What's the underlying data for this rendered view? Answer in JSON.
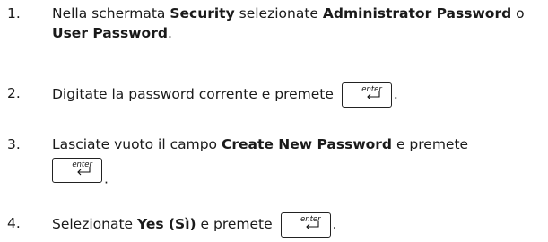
{
  "steps": [
    {
      "num": "1.",
      "t1": "Nella schermata ",
      "b1": "Security",
      "t2": " selezionate ",
      "b2": "Administrator Password",
      "t3": " o",
      "b3": "User Password",
      "t4": "."
    },
    {
      "num": "2.",
      "t1": "Digitate la password corrente e premete",
      "t2": "."
    },
    {
      "num": "3.",
      "t1": "Lasciate vuoto il campo ",
      "b1": "Create New Password",
      "t2": " e premete",
      "t3": "."
    },
    {
      "num": "4.",
      "t1": "Selezionate ",
      "b1": "Yes (Sì)",
      "t2": " e premete",
      "t3": "."
    }
  ],
  "key": {
    "label": "enter",
    "icon": "enter-arrow-icon"
  }
}
